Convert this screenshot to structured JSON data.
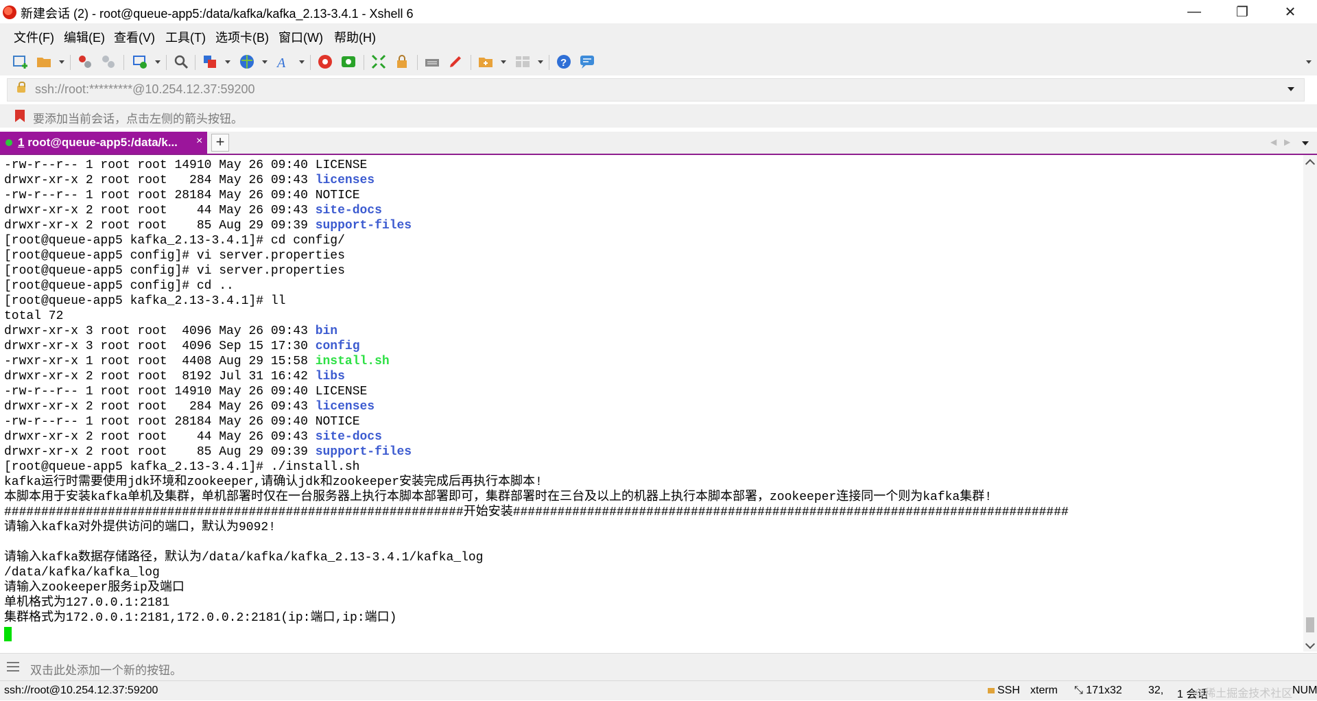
{
  "window": {
    "title": "新建会话 (2) - root@queue-app5:/data/kafka/kafka_2.13-3.4.1 - Xshell 6",
    "controls": {
      "minimize": "—",
      "restore": "❐",
      "close": "✕"
    }
  },
  "menu": [
    "文件(F)",
    "编辑(E)",
    "查看(V)",
    "工具(T)",
    "选项卡(B)",
    "窗口(W)",
    "帮助(H)"
  ],
  "toolbar": {
    "icons": [
      "new-session-icon",
      "open-folder-icon",
      "connect-icon",
      "disconnect-icon",
      "reconnect-icon",
      "find-icon",
      "copy-icon",
      "globe-icon",
      "font-icon",
      "xftp-icon",
      "xagent-icon",
      "fullscreen-icon",
      "lock-icon",
      "keyboard-icon",
      "highlight-icon",
      "compose-icon",
      "layout-icon",
      "help-icon",
      "chat-icon"
    ],
    "colors": {
      "red": "#e0342a",
      "green": "#2aa32a",
      "blue": "#2f6fd6",
      "orange": "#e8a23a",
      "gray": "#8a8a8a"
    }
  },
  "address": {
    "value": "ssh://root:*********@10.254.12.37:59200"
  },
  "hint": {
    "text": "要添加当前会话，点击左侧的箭头按钮。"
  },
  "tabs": [
    {
      "number": "1",
      "label": " root@queue-app5:/data/k...",
      "close": "×"
    }
  ],
  "tabbar": {
    "add": "+",
    "prev": "◀",
    "next": "▶"
  },
  "terminal": {
    "colors": {
      "directory": "#3c5bd0",
      "executable": "#2ee045",
      "text": "#000000",
      "cursor": "#00e000"
    },
    "lines": [
      {
        "text": "-rw-r--r-- 1 root root 14910 May 26 09:40 ",
        "name": "LICENSE",
        "style": "plain"
      },
      {
        "text": "drwxr-xr-x 2 root root   284 May 26 09:43 ",
        "name": "licenses",
        "style": "dir"
      },
      {
        "text": "-rw-r--r-- 1 root root 28184 May 26 09:40 ",
        "name": "NOTICE",
        "style": "plain"
      },
      {
        "text": "drwxr-xr-x 2 root root    44 May 26 09:43 ",
        "name": "site-docs",
        "style": "dir"
      },
      {
        "text": "drwxr-xr-x 2 root root    85 Aug 29 09:39 ",
        "name": "support-files",
        "style": "dir"
      },
      {
        "text": "[root@queue-app5 kafka_2.13-3.4.1]# cd config/",
        "name": "",
        "style": "plain"
      },
      {
        "text": "[root@queue-app5 config]# vi server.properties",
        "name": "",
        "style": "plain"
      },
      {
        "text": "[root@queue-app5 config]# vi server.properties",
        "name": "",
        "style": "plain"
      },
      {
        "text": "[root@queue-app5 config]# cd ..",
        "name": "",
        "style": "plain"
      },
      {
        "text": "[root@queue-app5 kafka_2.13-3.4.1]# ll",
        "name": "",
        "style": "plain"
      },
      {
        "text": "total 72",
        "name": "",
        "style": "plain"
      },
      {
        "text": "drwxr-xr-x 3 root root  4096 May 26 09:43 ",
        "name": "bin",
        "style": "dir"
      },
      {
        "text": "drwxr-xr-x 3 root root  4096 Sep 15 17:30 ",
        "name": "config",
        "style": "dir"
      },
      {
        "text": "-rwxr-xr-x 1 root root  4408 Aug 29 15:58 ",
        "name": "install.sh",
        "style": "exe"
      },
      {
        "text": "drwxr-xr-x 2 root root  8192 Jul 31 16:42 ",
        "name": "libs",
        "style": "dir"
      },
      {
        "text": "-rw-r--r-- 1 root root 14910 May 26 09:40 ",
        "name": "LICENSE",
        "style": "plain"
      },
      {
        "text": "drwxr-xr-x 2 root root   284 May 26 09:43 ",
        "name": "licenses",
        "style": "dir"
      },
      {
        "text": "-rw-r--r-- 1 root root 28184 May 26 09:40 ",
        "name": "NOTICE",
        "style": "plain"
      },
      {
        "text": "drwxr-xr-x 2 root root    44 May 26 09:43 ",
        "name": "site-docs",
        "style": "dir"
      },
      {
        "text": "drwxr-xr-x 2 root root    85 Aug 29 09:39 ",
        "name": "support-files",
        "style": "dir"
      },
      {
        "text": "[root@queue-app5 kafka_2.13-3.4.1]# ./install.sh",
        "name": "",
        "style": "plain"
      },
      {
        "text": "kafka运行时需要使用jdk环境和zookeeper,请确认jdk和zookeeper安装完成后再执行本脚本!",
        "name": "",
        "style": "plain"
      },
      {
        "text": "本脚本用于安装kafka单机及集群，单机部署时仅在一台服务器上执行本脚本部署即可，集群部署时在三台及以上的机器上执行本脚本部署，zookeeper连接同一个则为kafka集群!",
        "name": "",
        "style": "plain"
      },
      {
        "text": "##############################################################开始安装###########################################################################",
        "name": "",
        "style": "plain"
      },
      {
        "text": "请输入kafka对外提供访问的端口，默认为9092!",
        "name": "",
        "style": "plain"
      },
      {
        "text": "",
        "name": "",
        "style": "plain"
      },
      {
        "text": "请输入kafka数据存储路径，默认为/data/kafka/kafka_2.13-3.4.1/kafka_log",
        "name": "",
        "style": "plain"
      },
      {
        "text": "/data/kafka/kafka_log",
        "name": "",
        "style": "plain"
      },
      {
        "text": "请输入zookeeper服务ip及端口",
        "name": "",
        "style": "plain"
      },
      {
        "text": "单机格式为127.0.0.1:2181",
        "name": "",
        "style": "plain"
      },
      {
        "text": "集群格式为172.0.0.1:2181,172.0.0.2:2181(ip:端口,ip:端口)",
        "name": "",
        "style": "plain"
      }
    ]
  },
  "compose": {
    "text": "双击此处添加一个新的按钮。"
  },
  "status": {
    "connection": "ssh://root@10.254.12.37:59200",
    "protocol": "SSH",
    "terminal_type": "xterm",
    "size": "171x32",
    "cursor_pos": "32,",
    "sessions": "1 会话",
    "num": "NUM",
    "watermark": "@稀土掘金技术社区"
  }
}
